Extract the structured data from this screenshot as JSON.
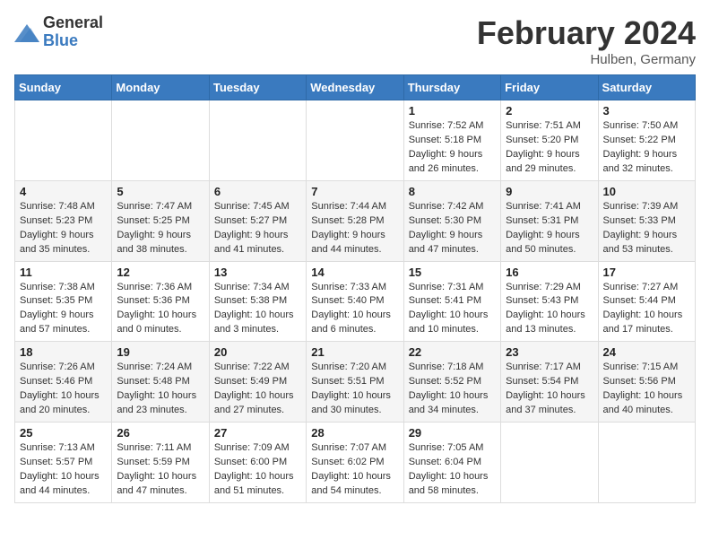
{
  "header": {
    "logo_general": "General",
    "logo_blue": "Blue",
    "month_title": "February 2024",
    "location": "Hulben, Germany"
  },
  "days_of_week": [
    "Sunday",
    "Monday",
    "Tuesday",
    "Wednesday",
    "Thursday",
    "Friday",
    "Saturday"
  ],
  "weeks": [
    {
      "cells": [
        {
          "empty": true
        },
        {
          "empty": true
        },
        {
          "empty": true
        },
        {
          "empty": true
        },
        {
          "day": 1,
          "sunrise": "7:52 AM",
          "sunset": "5:18 PM",
          "daylight": "9 hours and 26 minutes."
        },
        {
          "day": 2,
          "sunrise": "7:51 AM",
          "sunset": "5:20 PM",
          "daylight": "9 hours and 29 minutes."
        },
        {
          "day": 3,
          "sunrise": "7:50 AM",
          "sunset": "5:22 PM",
          "daylight": "9 hours and 32 minutes."
        }
      ]
    },
    {
      "cells": [
        {
          "day": 4,
          "sunrise": "7:48 AM",
          "sunset": "5:23 PM",
          "daylight": "9 hours and 35 minutes."
        },
        {
          "day": 5,
          "sunrise": "7:47 AM",
          "sunset": "5:25 PM",
          "daylight": "9 hours and 38 minutes."
        },
        {
          "day": 6,
          "sunrise": "7:45 AM",
          "sunset": "5:27 PM",
          "daylight": "9 hours and 41 minutes."
        },
        {
          "day": 7,
          "sunrise": "7:44 AM",
          "sunset": "5:28 PM",
          "daylight": "9 hours and 44 minutes."
        },
        {
          "day": 8,
          "sunrise": "7:42 AM",
          "sunset": "5:30 PM",
          "daylight": "9 hours and 47 minutes."
        },
        {
          "day": 9,
          "sunrise": "7:41 AM",
          "sunset": "5:31 PM",
          "daylight": "9 hours and 50 minutes."
        },
        {
          "day": 10,
          "sunrise": "7:39 AM",
          "sunset": "5:33 PM",
          "daylight": "9 hours and 53 minutes."
        }
      ]
    },
    {
      "cells": [
        {
          "day": 11,
          "sunrise": "7:38 AM",
          "sunset": "5:35 PM",
          "daylight": "9 hours and 57 minutes."
        },
        {
          "day": 12,
          "sunrise": "7:36 AM",
          "sunset": "5:36 PM",
          "daylight": "10 hours and 0 minutes."
        },
        {
          "day": 13,
          "sunrise": "7:34 AM",
          "sunset": "5:38 PM",
          "daylight": "10 hours and 3 minutes."
        },
        {
          "day": 14,
          "sunrise": "7:33 AM",
          "sunset": "5:40 PM",
          "daylight": "10 hours and 6 minutes."
        },
        {
          "day": 15,
          "sunrise": "7:31 AM",
          "sunset": "5:41 PM",
          "daylight": "10 hours and 10 minutes."
        },
        {
          "day": 16,
          "sunrise": "7:29 AM",
          "sunset": "5:43 PM",
          "daylight": "10 hours and 13 minutes."
        },
        {
          "day": 17,
          "sunrise": "7:27 AM",
          "sunset": "5:44 PM",
          "daylight": "10 hours and 17 minutes."
        }
      ]
    },
    {
      "cells": [
        {
          "day": 18,
          "sunrise": "7:26 AM",
          "sunset": "5:46 PM",
          "daylight": "10 hours and 20 minutes."
        },
        {
          "day": 19,
          "sunrise": "7:24 AM",
          "sunset": "5:48 PM",
          "daylight": "10 hours and 23 minutes."
        },
        {
          "day": 20,
          "sunrise": "7:22 AM",
          "sunset": "5:49 PM",
          "daylight": "10 hours and 27 minutes."
        },
        {
          "day": 21,
          "sunrise": "7:20 AM",
          "sunset": "5:51 PM",
          "daylight": "10 hours and 30 minutes."
        },
        {
          "day": 22,
          "sunrise": "7:18 AM",
          "sunset": "5:52 PM",
          "daylight": "10 hours and 34 minutes."
        },
        {
          "day": 23,
          "sunrise": "7:17 AM",
          "sunset": "5:54 PM",
          "daylight": "10 hours and 37 minutes."
        },
        {
          "day": 24,
          "sunrise": "7:15 AM",
          "sunset": "5:56 PM",
          "daylight": "10 hours and 40 minutes."
        }
      ]
    },
    {
      "cells": [
        {
          "day": 25,
          "sunrise": "7:13 AM",
          "sunset": "5:57 PM",
          "daylight": "10 hours and 44 minutes."
        },
        {
          "day": 26,
          "sunrise": "7:11 AM",
          "sunset": "5:59 PM",
          "daylight": "10 hours and 47 minutes."
        },
        {
          "day": 27,
          "sunrise": "7:09 AM",
          "sunset": "6:00 PM",
          "daylight": "10 hours and 51 minutes."
        },
        {
          "day": 28,
          "sunrise": "7:07 AM",
          "sunset": "6:02 PM",
          "daylight": "10 hours and 54 minutes."
        },
        {
          "day": 29,
          "sunrise": "7:05 AM",
          "sunset": "6:04 PM",
          "daylight": "10 hours and 58 minutes."
        },
        {
          "empty": true
        },
        {
          "empty": true
        }
      ]
    }
  ],
  "labels": {
    "sunrise": "Sunrise:",
    "sunset": "Sunset:",
    "daylight": "Daylight:"
  }
}
